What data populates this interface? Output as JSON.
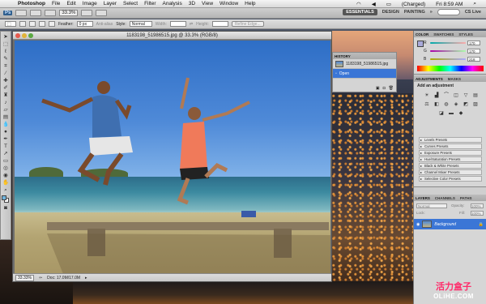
{
  "menubar": {
    "app": "Photoshop",
    "items": [
      "File",
      "Edit",
      "Image",
      "Layer",
      "Select",
      "Filter",
      "Analysis",
      "3D",
      "View",
      "Window",
      "Help"
    ],
    "battery": "(Charged)",
    "clock": "Fri 8:59 AM"
  },
  "appbar": {
    "logo": "Ps",
    "zoom": "33.3%",
    "workspaces": {
      "active": "ESSENTIALS",
      "design": "DESIGN",
      "painting": "PAINTING"
    },
    "cslive": "CS Live"
  },
  "options": {
    "feather_label": "Feather:",
    "feather_value": "0 px",
    "antialias": "Anti-alias",
    "style_label": "Style:",
    "style_value": "Normal",
    "width_label": "Width:",
    "height_label": "Height:",
    "refine_edge": "Refine Edge..."
  },
  "document": {
    "title": "1183198_51986515.jpg @ 33.3% (RGB/8)",
    "zoom": "33.33%",
    "doc_size": "Doc: 17.0M/17.0M"
  },
  "history": {
    "tab": "HISTORY",
    "snapshot": "1183198_51986515.jpg",
    "state": "Open"
  },
  "color_panel": {
    "tabs": [
      "COLOR",
      "SWATCHES",
      "STYLES"
    ],
    "channels": [
      {
        "label": "R",
        "value": "170"
      },
      {
        "label": "G",
        "value": "170"
      },
      {
        "label": "B",
        "value": "218"
      }
    ]
  },
  "adjustments": {
    "tabs": [
      "ADJUSTMENTS",
      "MASKS"
    ],
    "heading": "Add an adjustment",
    "icons": [
      "brightness-contrast-icon",
      "levels-icon",
      "curves-icon",
      "exposure-icon",
      "vibrance-icon",
      "hue-saturation-icon",
      "color-balance-icon",
      "black-white-icon",
      "photo-filter-icon",
      "channel-mixer-icon",
      "invert-icon",
      "posterize-icon",
      "threshold-icon",
      "gradient-map-icon",
      "selective-color-icon"
    ],
    "presets": [
      "Levels Presets",
      "Curves Presets",
      "Exposure Presets",
      "Hue/Saturation Presets",
      "Black & White Presets",
      "Channel Mixer Presets",
      "Selective Color Presets"
    ]
  },
  "layers": {
    "tabs": [
      "LAYERS",
      "CHANNELS",
      "PATHS"
    ],
    "blend_mode": "Normal",
    "opacity_label": "Opacity:",
    "opacity": "100%",
    "lock_label": "Lock:",
    "fill_label": "Fill:",
    "fill": "100%",
    "layer_name": "Background"
  },
  "watermark": {
    "cn": "活力盒子",
    "en": "OLiHE.COM"
  },
  "colors": {
    "accent": "#3b76d6",
    "fg": "#6fb3dd"
  }
}
